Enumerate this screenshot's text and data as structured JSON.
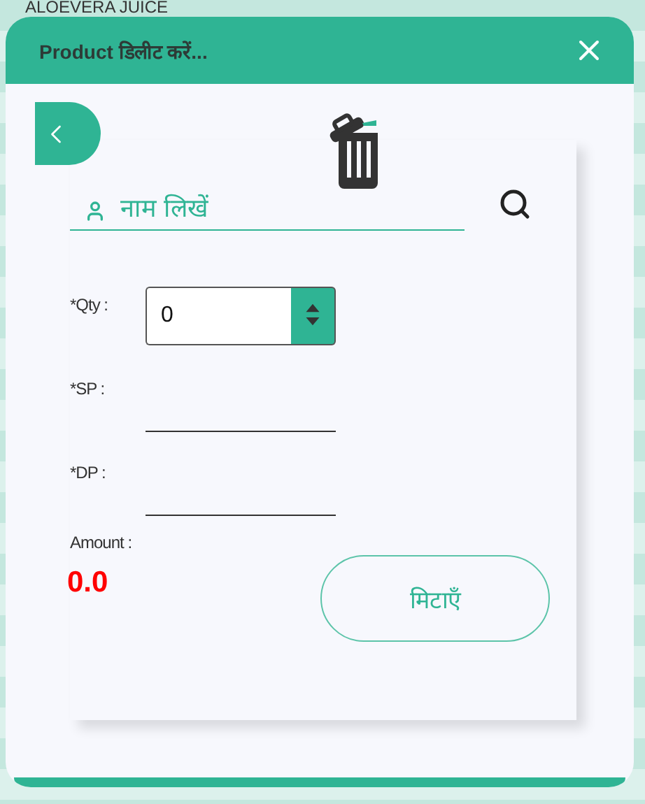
{
  "background": {
    "text": "ALOEVERA JUICE"
  },
  "dialog": {
    "title": "Product डिलीट करें..."
  },
  "search": {
    "placeholder": "नाम लिखें"
  },
  "fields": [
    {
      "label": "*Qty :",
      "kind": "spinner",
      "value": "0"
    },
    {
      "label": "*SP :",
      "kind": "line"
    },
    {
      "label": "*DP :",
      "kind": "line"
    }
  ],
  "amount": {
    "label": "Amount :",
    "value": "0.0"
  },
  "delete_button": "मिटाएँ"
}
